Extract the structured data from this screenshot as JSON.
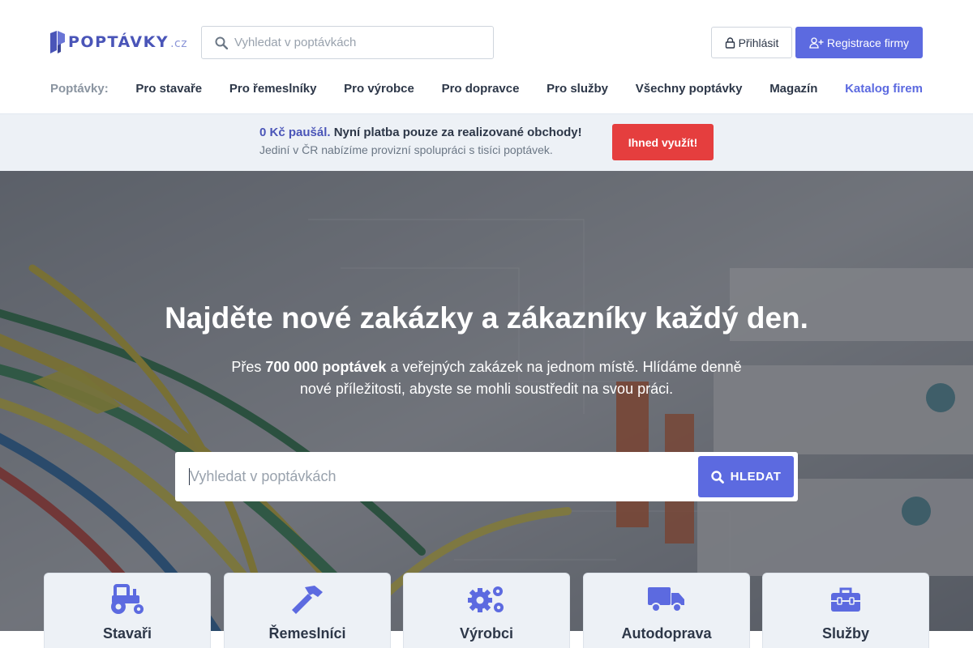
{
  "header": {
    "logo_text": "POPTÁVKY",
    "logo_tld": ".cz",
    "search_placeholder": "Vyhledat v poptávkách",
    "login_label": "Přihlásit",
    "register_label": "Registrace firmy"
  },
  "nav": {
    "label": "Poptávky:",
    "items": [
      {
        "label": "Pro stavaře"
      },
      {
        "label": "Pro řemeslníky"
      },
      {
        "label": "Pro výrobce"
      },
      {
        "label": "Pro dopravce"
      },
      {
        "label": "Pro služby"
      },
      {
        "label": "Všechny poptávky"
      },
      {
        "label": "Magazín"
      },
      {
        "label": "Katalog firem"
      }
    ]
  },
  "promo": {
    "highlight": "0 Kč paušál.",
    "headline": "Nyní platba pouze za realizované obchody!",
    "subline": "Jediní v ČR nabízíme provizní spolupráci s tisíci poptávek.",
    "button_label": "Ihned využít!"
  },
  "hero": {
    "title": "Najděte nové zakázky a zákazníky každý den.",
    "sub_prefix": "Přes",
    "sub_bold": "700 000 poptávek",
    "sub_rest": "a veřejných zakázek na jednom místě. Hlídáme denně nové příležitosti, abyste se mohli soustředit na svou práci.",
    "search_placeholder": "Vyhledat v poptávkách",
    "search_button": "HLEDAT"
  },
  "categories": [
    {
      "label": "Stavaři",
      "icon": "tractor-icon"
    },
    {
      "label": "Řemeslníci",
      "icon": "hammer-icon"
    },
    {
      "label": "Výrobci",
      "icon": "gears-icon"
    },
    {
      "label": "Autodoprava",
      "icon": "truck-icon"
    },
    {
      "label": "Služby",
      "icon": "toolbox-icon"
    }
  ],
  "colors": {
    "accent": "#5c6ae0",
    "brand": "#4a55b8",
    "promo_button": "#e53e3e",
    "promo_bg": "#edf1f6"
  }
}
